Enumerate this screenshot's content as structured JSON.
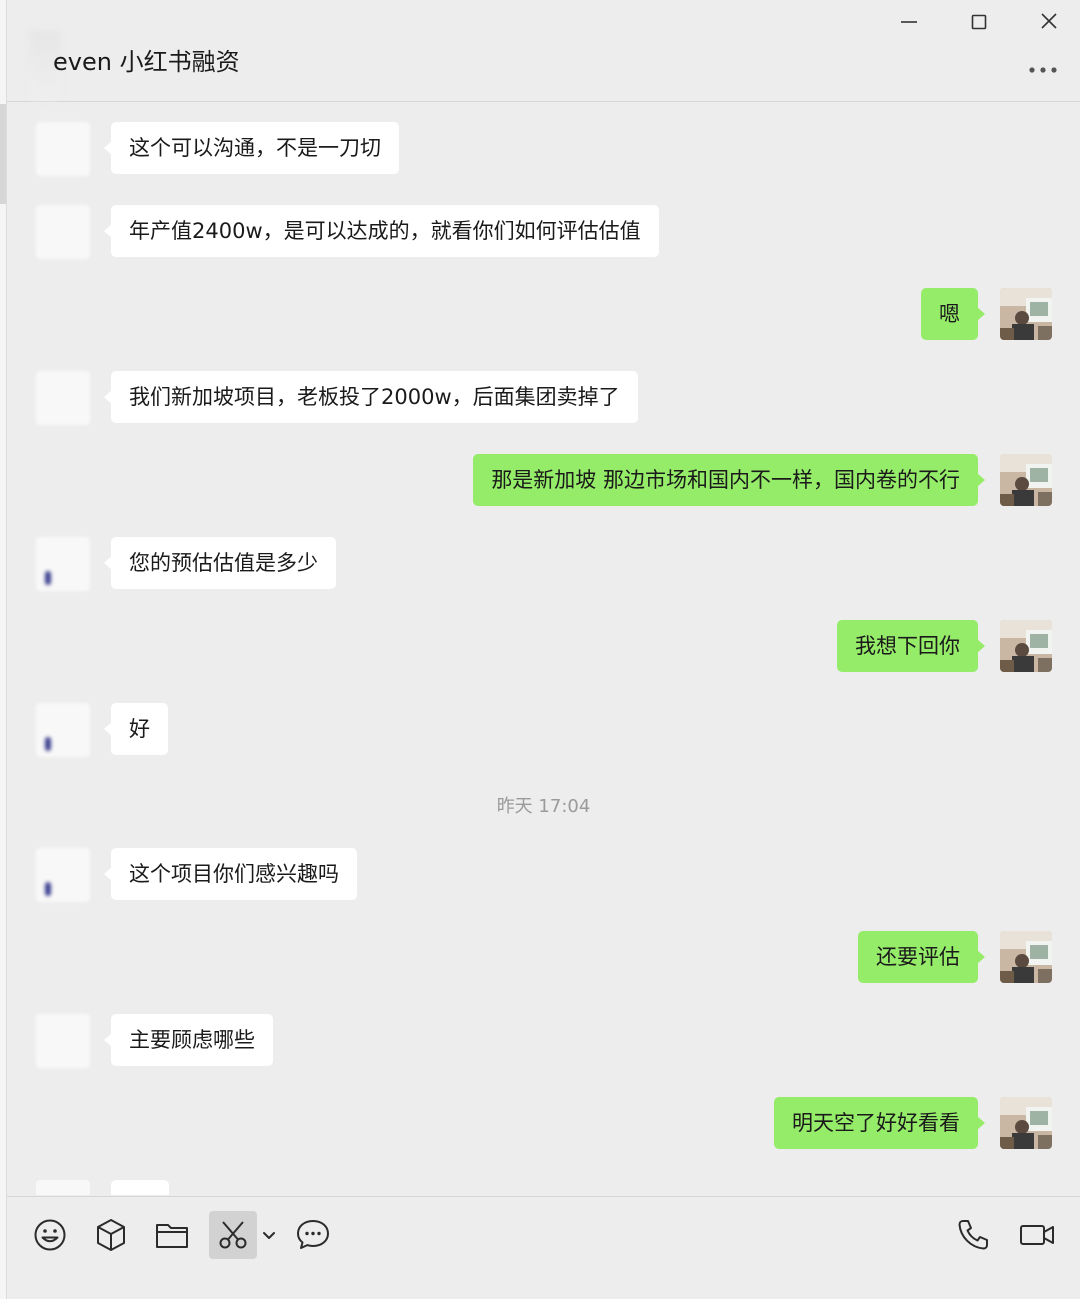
{
  "window": {
    "title": "even 小红书融资"
  },
  "colors": {
    "background": "#ededed",
    "incoming_bubble": "#ffffff",
    "outgoing_bubble": "#95ec69",
    "timestamp_text": "#9a9a9a"
  },
  "messages": [
    {
      "side": "in",
      "text": "这个可以沟通，不是一刀切"
    },
    {
      "side": "in",
      "text": "年产值2400w，是可以达成的，就看你们如何评估估值"
    },
    {
      "side": "out",
      "text": "嗯"
    },
    {
      "side": "in",
      "text": "我们新加坡项目，老板投了2000w，后面集团卖掉了"
    },
    {
      "side": "out",
      "text": "那是新加坡 那边市场和国内不一样，国内卷的不行"
    },
    {
      "side": "in",
      "text": "您的预估估值是多少"
    },
    {
      "side": "out",
      "text": "我想下回你"
    },
    {
      "side": "in",
      "text": "好"
    },
    {
      "side": "time",
      "text": "昨天 17:04"
    },
    {
      "side": "in",
      "text": "这个项目你们感兴趣吗"
    },
    {
      "side": "out",
      "text": "还要评估"
    },
    {
      "side": "in",
      "text": "主要顾虑哪些"
    },
    {
      "side": "out",
      "text": "明天空了好好看看"
    }
  ],
  "toolbar": {
    "left_icons": [
      "emoji-icon",
      "box-icon",
      "folder-icon",
      "scissors-icon",
      "chevron-down-icon",
      "chat-bubble-icon"
    ],
    "right_icons": [
      "phone-icon",
      "video-icon"
    ]
  }
}
